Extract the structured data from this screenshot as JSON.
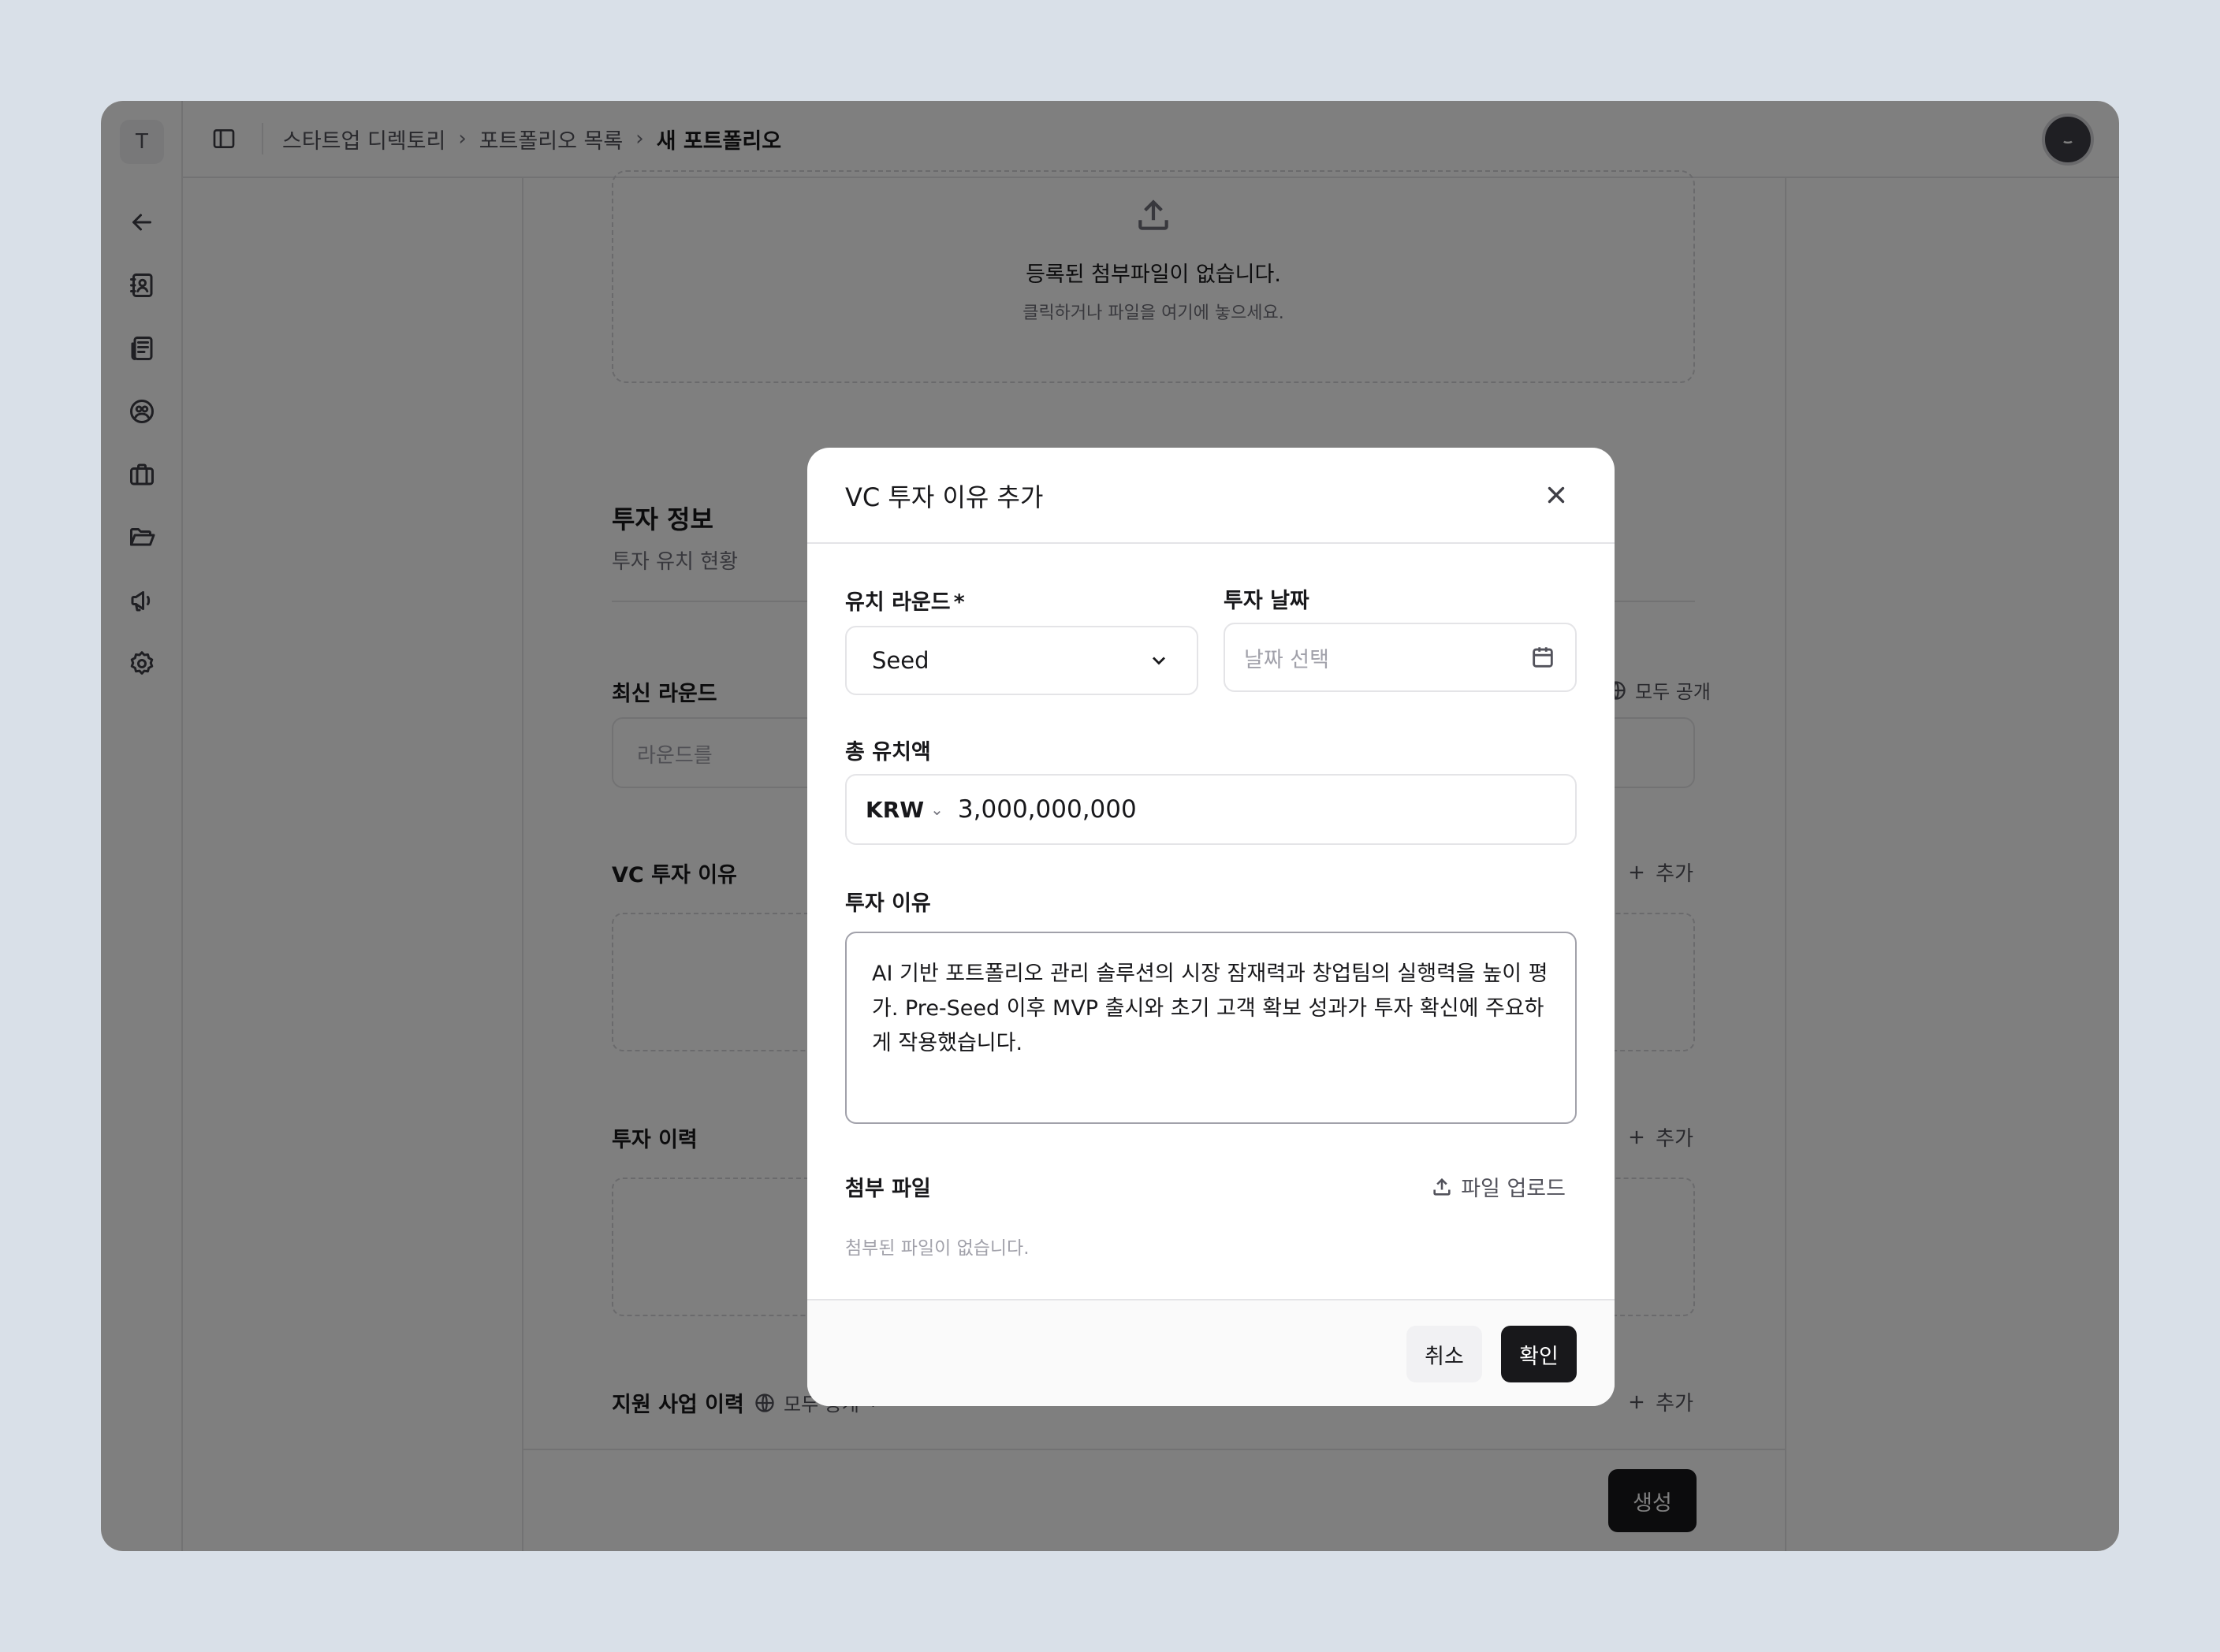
{
  "sidebar": {
    "workspace_initial": "T",
    "icons": [
      "back-arrow-icon",
      "contacts-icon",
      "news-icon",
      "users-icon",
      "briefcase-icon",
      "folder-icon",
      "megaphone-icon",
      "settings-icon"
    ]
  },
  "breadcrumb": {
    "items": [
      "스타트업 디렉토리",
      "포트폴리오 목록"
    ],
    "current": "새 포트폴리오"
  },
  "background": {
    "attachment_empty_title": "등록된 첨부파일이 없습니다.",
    "attachment_empty_hint": "클릭하거나 파일을 여기에 놓으세요.",
    "invest_section_title": "투자 정보",
    "invest_section_sub": "투자 유치 현황",
    "latest_round_label": "최신 라운드",
    "latest_round_placeholder": "라운드를",
    "public_label": "모두 공개",
    "vc_reason_label": "VC 투자 이유",
    "add_label": "추가",
    "history_label": "투자 이력",
    "support_label": "지원 사업 이력",
    "create_label": "생성"
  },
  "modal": {
    "title": "VC 투자 이유 추가",
    "round_label": "유치 라운드",
    "round_required": "*",
    "round_value": "Seed",
    "date_label": "투자 날짜",
    "date_placeholder": "날짜 선택",
    "amount_label": "총 유치액",
    "currency": "KRW",
    "amount_value": "3,000,000,000",
    "reason_label": "투자 이유",
    "reason_value": "AI 기반 포트폴리오 관리 솔루션의 시장 잠재력과 창업팀의 실행력을 높이 평가. Pre-Seed 이후 MVP 출시와 초기 고객 확보 성과가 투자 확신에 주요하게 작용했습니다.",
    "attach_label": "첨부 파일",
    "upload_label": "파일 업로드",
    "no_files": "첨부된 파일이 없습니다.",
    "cancel_label": "취소",
    "confirm_label": "확인"
  }
}
